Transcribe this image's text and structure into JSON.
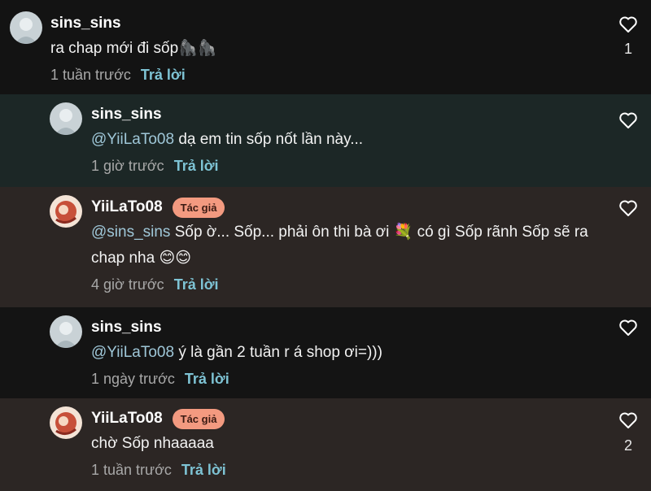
{
  "comments": [
    {
      "username": "sins_sins",
      "avatar": "avatar-sins",
      "badge": "",
      "mention": "",
      "text": "ra chap mới đi sốp🦍🦍",
      "time": "1 tuần trước",
      "reply_label": "Trả lời",
      "likes": "1"
    },
    {
      "username": "sins_sins",
      "avatar": "avatar-sins",
      "badge": "",
      "mention": "@YiiLaTo08",
      "text": " dạ em tin sốp nốt lần này...",
      "time": "1 giờ trước",
      "reply_label": "Trả lời",
      "likes": ""
    },
    {
      "username": "YiiLaTo08",
      "avatar": "avatar-yii",
      "badge": "Tác giả",
      "mention": "@sins_sins",
      "text": " Sốp ờ... Sốp... phải ôn thi bà ơi 💐 có gì Sốp rãnh Sốp sẽ ra chap nha 😊😊",
      "time": "4 giờ trước",
      "reply_label": "Trả lời",
      "likes": ""
    },
    {
      "username": "sins_sins",
      "avatar": "avatar-sins",
      "badge": "",
      "mention": "@YiiLaTo08",
      "text": " ý là gần 2 tuần r á shop ơi=)))",
      "time": "1 ngày trước",
      "reply_label": "Trả lời",
      "likes": ""
    },
    {
      "username": "YiiLaTo08",
      "avatar": "avatar-yii",
      "badge": "Tác giả",
      "mention": "",
      "text": "chờ Sốp nhaaaaa",
      "time": "1 tuần trước",
      "reply_label": "Trả lời",
      "likes": "2"
    }
  ],
  "icons": {
    "like": "heart-outline-icon"
  },
  "colors": {
    "mention": "#9fc7d8",
    "reply_link": "#7ec3d4",
    "badge_bg": "#f39a80",
    "reply_bg_1": "#1c2726",
    "reply_bg_2": "#2c2624"
  }
}
